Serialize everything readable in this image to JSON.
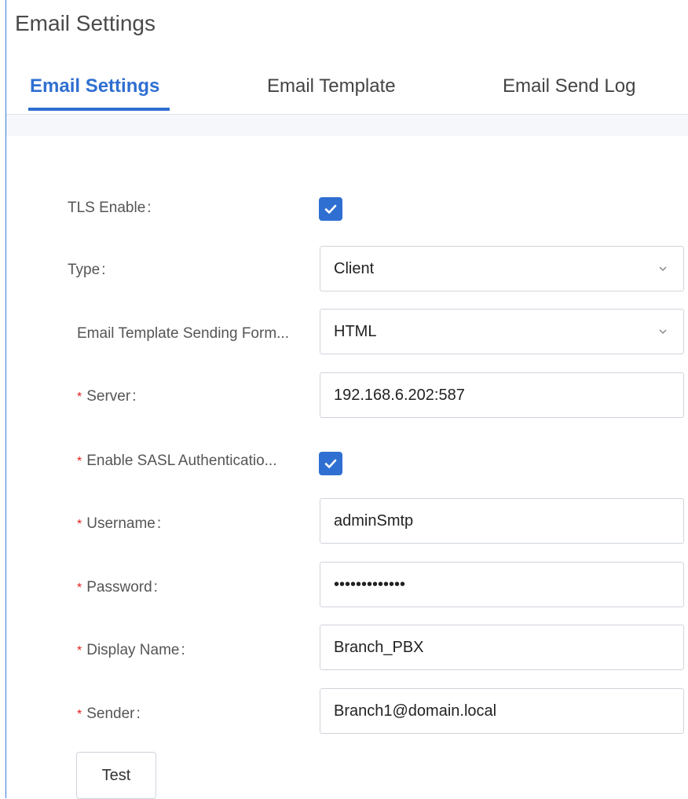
{
  "page": {
    "title": "Email Settings"
  },
  "tabs": [
    {
      "label": "Email Settings",
      "active": true
    },
    {
      "label": "Email Template",
      "active": false
    },
    {
      "label": "Email Send Log",
      "active": false
    }
  ],
  "colors": {
    "accent": "#2f6fd1",
    "required": "#e02020"
  },
  "form": {
    "tls_enable": {
      "label": "TLS Enable",
      "checked": true,
      "icon": "check-icon"
    },
    "type": {
      "label": "Type",
      "value": "Client"
    },
    "sending_format": {
      "label": "Email Template Sending Form...",
      "value": "HTML"
    },
    "server": {
      "label": "Server",
      "value": "192.168.6.202:587",
      "required": true
    },
    "sasl": {
      "label": "Enable SASL Authenticatio...",
      "checked": true,
      "required": true
    },
    "username": {
      "label": "Username",
      "value": "adminSmtp",
      "required": true
    },
    "password": {
      "label": "Password",
      "value": "•••••••••••••",
      "required": true
    },
    "display_name": {
      "label": "Display Name",
      "value": "Branch_PBX",
      "required": true
    },
    "sender": {
      "label": "Sender",
      "value": "Branch1@domain.local",
      "required": true
    }
  },
  "test_button": {
    "label": "Test"
  },
  "punct": {
    "colon": ":",
    "req": "*"
  }
}
